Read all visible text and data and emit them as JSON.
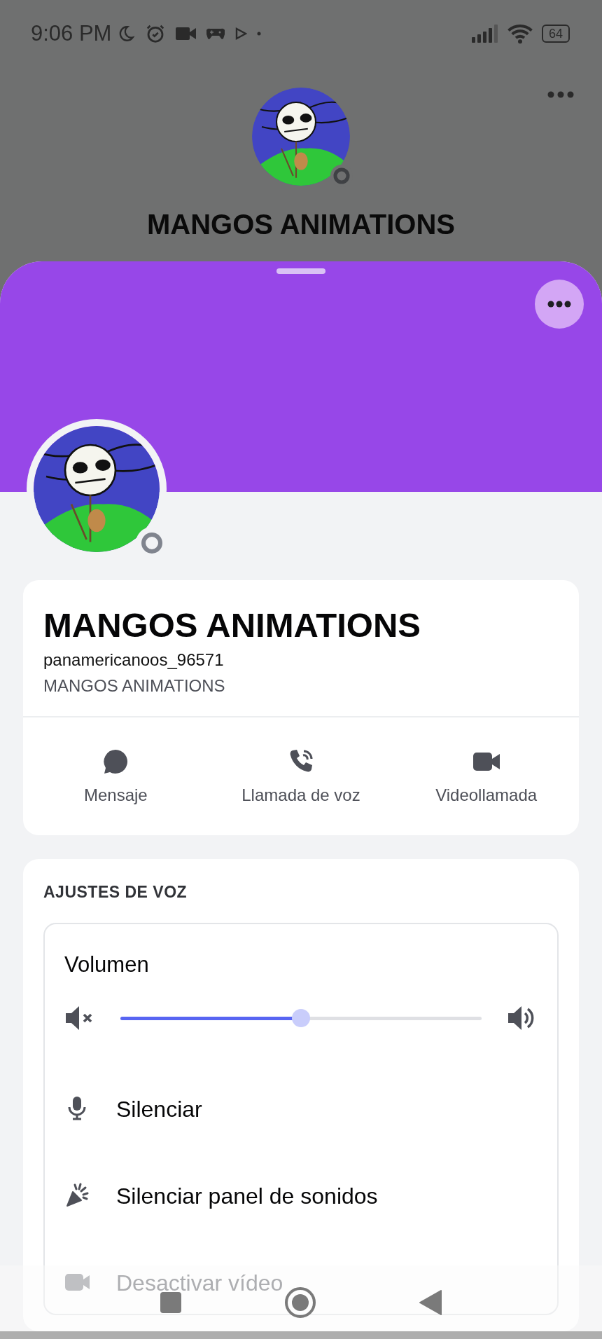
{
  "status_bar": {
    "time": "9:06 PM",
    "battery": "64"
  },
  "header": {
    "title": "MANGOS ANIMATIONS"
  },
  "profile": {
    "display_name": "MANGOS ANIMATIONS",
    "username": "panamericanoos_96571",
    "about": "MANGOS ANIMATIONS"
  },
  "actions": [
    {
      "label": "Mensaje"
    },
    {
      "label": "Llamada de voz"
    },
    {
      "label": "Videollamada"
    }
  ],
  "voice_settings": {
    "heading": "AJUSTES DE VOZ",
    "items": [
      {
        "kind": "slider",
        "label": "Volumen",
        "level": 0.5
      },
      {
        "kind": "action",
        "label": "Silenciar",
        "disabled": false
      },
      {
        "kind": "action",
        "label": "Silenciar panel de sonidos",
        "disabled": false
      },
      {
        "kind": "action",
        "label": "Desactivar vídeo",
        "disabled": true
      }
    ]
  }
}
